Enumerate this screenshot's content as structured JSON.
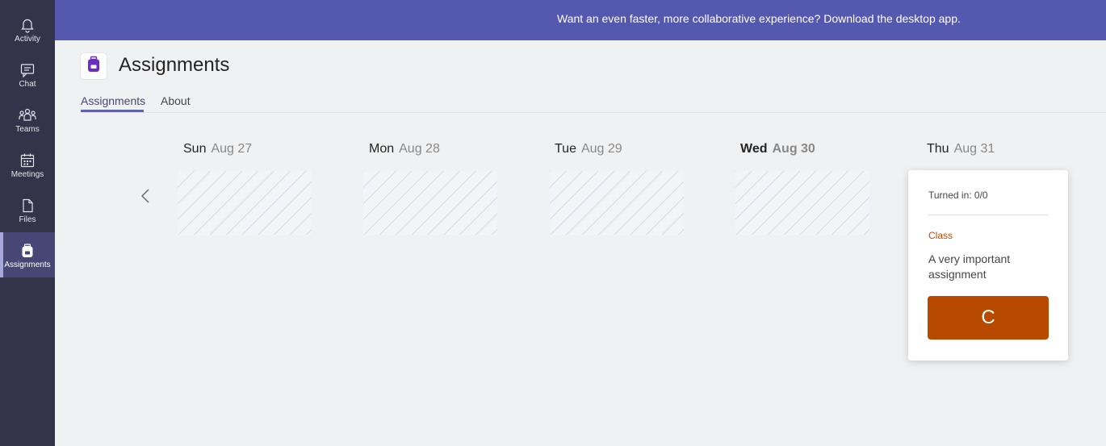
{
  "rail": {
    "items": [
      {
        "label": "Activity",
        "icon": "bell-icon",
        "active": false
      },
      {
        "label": "Chat",
        "icon": "chat-icon",
        "active": false
      },
      {
        "label": "Teams",
        "icon": "teams-icon",
        "active": false
      },
      {
        "label": "Meetings",
        "icon": "calendar-icon",
        "active": false
      },
      {
        "label": "Files",
        "icon": "file-icon",
        "active": false
      },
      {
        "label": "Assignments",
        "icon": "backpack-icon",
        "active": true
      }
    ]
  },
  "banner": {
    "text": "Want an even faster, more collaborative experience? Download the desktop app."
  },
  "header": {
    "title": "Assignments",
    "tabs": [
      {
        "label": "Assignments",
        "active": true
      },
      {
        "label": "About",
        "active": false
      }
    ]
  },
  "calendar": {
    "days": [
      {
        "dow": "Sun",
        "date": "Aug 27",
        "today": false
      },
      {
        "dow": "Mon",
        "date": "Aug 28",
        "today": false
      },
      {
        "dow": "Tue",
        "date": "Aug 29",
        "today": false
      },
      {
        "dow": "Wed",
        "date": "Aug 30",
        "today": true
      },
      {
        "dow": "Thu",
        "date": "Aug 31",
        "today": false
      }
    ]
  },
  "assignment_card": {
    "turned_in": "Turned in: 0/0",
    "class": "Class",
    "title": "A very important assignment",
    "class_initial": "C"
  },
  "colors": {
    "rail_bg": "#33344a",
    "banner_bg": "#5558af",
    "accent": "#6264a7",
    "class_color": "#b84a00"
  }
}
